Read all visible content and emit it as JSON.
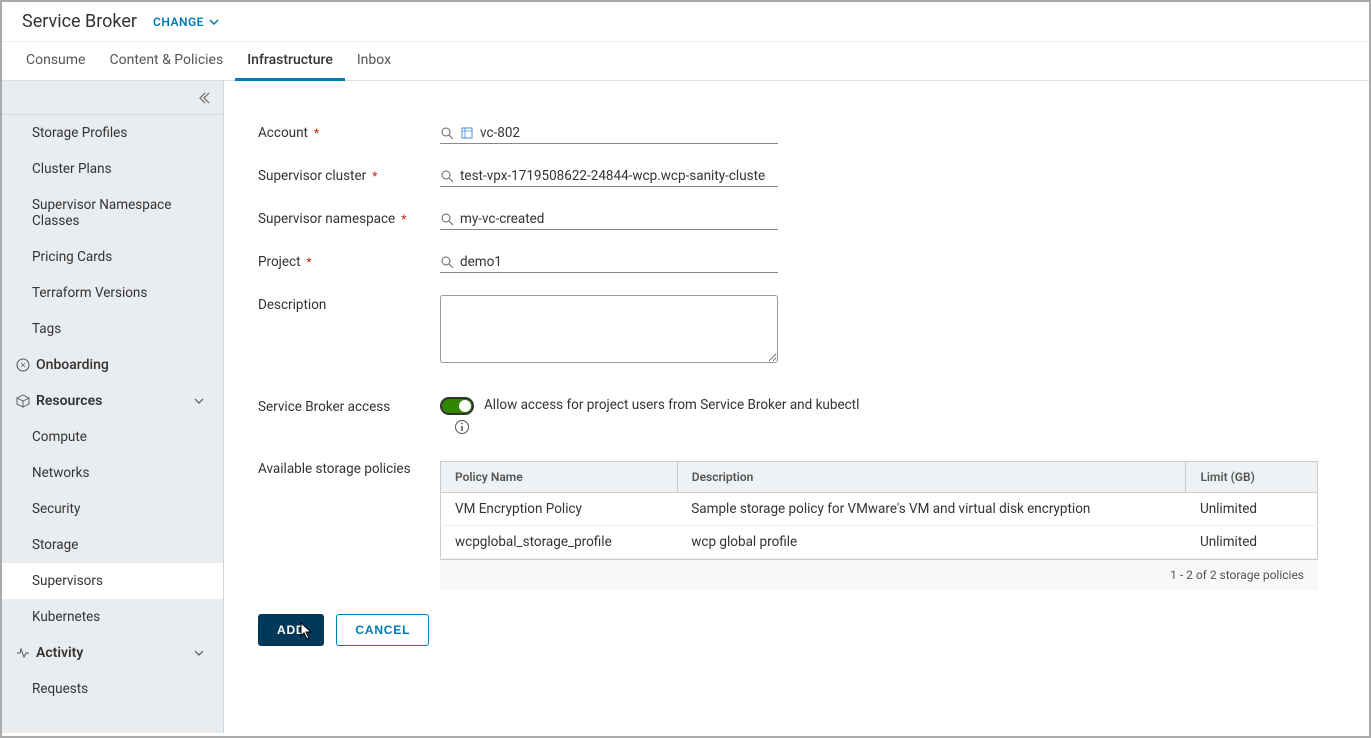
{
  "header": {
    "title": "Service Broker",
    "change": "CHANGE"
  },
  "tabs": [
    {
      "label": "Consume",
      "active": false
    },
    {
      "label": "Content & Policies",
      "active": false
    },
    {
      "label": "Infrastructure",
      "active": true
    },
    {
      "label": "Inbox",
      "active": false
    }
  ],
  "sidebar": {
    "top_items": [
      "Storage Profiles",
      "Cluster Plans",
      "Supervisor Namespace Classes",
      "Pricing Cards",
      "Terraform Versions",
      "Tags"
    ],
    "onboarding": "Onboarding",
    "resources": {
      "label": "Resources",
      "items": [
        "Compute",
        "Networks",
        "Security",
        "Storage",
        "Supervisors",
        "Kubernetes"
      ],
      "active": "Supervisors"
    },
    "activity": {
      "label": "Activity",
      "items": [
        "Requests"
      ]
    }
  },
  "form": {
    "account": {
      "label": "Account",
      "value": "vc-802"
    },
    "cluster": {
      "label": "Supervisor cluster",
      "value": "test-vpx-1719508622-24844-wcp.wcp-sanity-cluste"
    },
    "namespace": {
      "label": "Supervisor namespace",
      "value": "my-vc-created"
    },
    "project": {
      "label": "Project",
      "value": "demo1"
    },
    "description": {
      "label": "Description",
      "value": ""
    },
    "access": {
      "label": "Service Broker access",
      "text": "Allow access for project users from Service Broker and kubectl"
    },
    "policies": {
      "label": "Available storage policies",
      "headers": [
        "Policy Name",
        "Description",
        "Limit (GB)"
      ],
      "rows": [
        {
          "name": "VM Encryption Policy",
          "desc": "Sample storage policy for VMware's VM and virtual disk encryption",
          "limit": "Unlimited"
        },
        {
          "name": "wcpglobal_storage_profile",
          "desc": "wcp global profile",
          "limit": "Unlimited"
        }
      ],
      "footer": "1 - 2 of 2 storage policies"
    }
  },
  "buttons": {
    "add": "ADD",
    "cancel": "CANCEL"
  }
}
